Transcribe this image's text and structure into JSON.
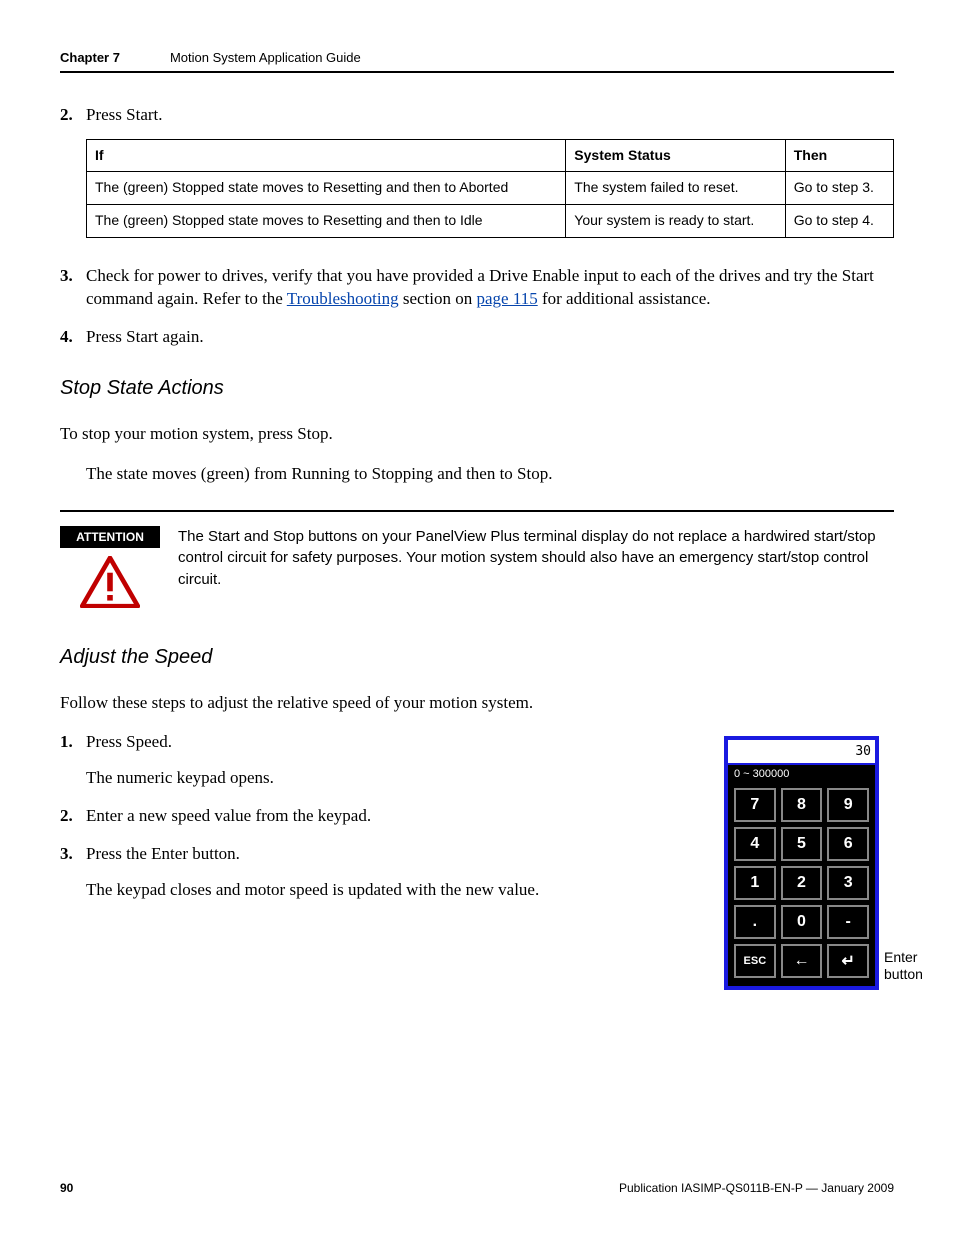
{
  "header": {
    "chapter": "Chapter 7",
    "title": "Motion System Application Guide"
  },
  "step2": {
    "num": "2.",
    "text": "Press Start."
  },
  "table": {
    "headers": {
      "if": "If",
      "status": "System Status",
      "then": "Then"
    },
    "rows": [
      {
        "if": "The (green) Stopped state moves to Resetting and then to Aborted",
        "status": "The system failed to reset.",
        "then": "Go to step 3."
      },
      {
        "if": "The (green) Stopped state moves to Resetting and then to Idle",
        "status": "Your system is ready to start.",
        "then": "Go to step 4."
      }
    ]
  },
  "step3": {
    "num": "3.",
    "pre": "Check for power to drives, verify that you have provided a Drive Enable input to each of the drives and try the Start command again. Refer to the ",
    "link1": "Troubleshooting",
    "mid": " section on ",
    "link2": "page 115",
    "post": " for additional assistance."
  },
  "step4": {
    "num": "4.",
    "text": "Press Start again."
  },
  "stop": {
    "heading": "Stop State Actions",
    "body1": "To stop your motion system, press Stop.",
    "body2": "The state moves (green) from Running to Stopping and then to Stop."
  },
  "attention": {
    "label": "ATTENTION",
    "text": "The Start and Stop buttons on your PanelView Plus terminal display do not replace a hardwired start/stop control circuit for safety purposes. Your motion system should also have an emergency start/stop control circuit."
  },
  "adjust": {
    "heading": "Adjust the Speed",
    "intro": "Follow these steps to adjust the relative speed of your motion system.",
    "steps": [
      {
        "num": "1.",
        "text": "Press Speed.",
        "sub": "The numeric keypad opens."
      },
      {
        "num": "2.",
        "text": "Enter a new speed value from the keypad."
      },
      {
        "num": "3.",
        "text": "Press the Enter button.",
        "sub": "The keypad closes and motor speed is updated with the new value."
      }
    ]
  },
  "keypad": {
    "display": "30",
    "range": "0 ~ 300000",
    "keys": [
      "7",
      "8",
      "9",
      "4",
      "5",
      "6",
      "1",
      "2",
      "3",
      ".",
      "0",
      "-",
      "ESC",
      "←",
      "↵"
    ],
    "enter_label_l1": "Enter",
    "enter_label_l2": "button"
  },
  "footer": {
    "page": "90",
    "pub": "Publication IASIMP-QS011B-EN-P — January 2009"
  }
}
